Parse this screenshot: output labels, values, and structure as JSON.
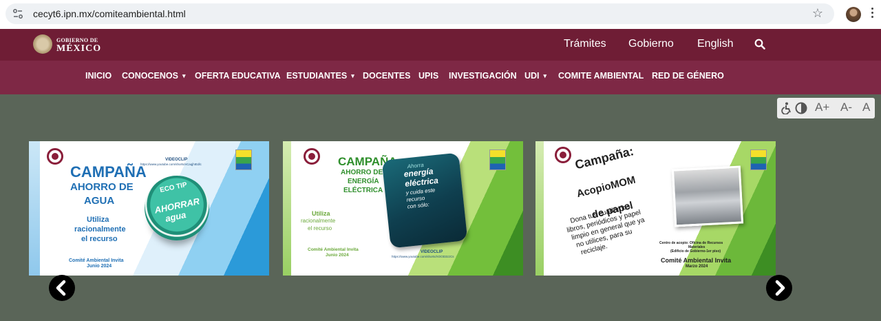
{
  "browser": {
    "url": "cecyt6.ipn.mx/comiteambiental.html",
    "icons": [
      "site-info-icon",
      "bookmark-star-icon",
      "profile-avatar",
      "kebab-menu-icon"
    ]
  },
  "gov_header": {
    "logo_small": "GOBIERNO DE",
    "logo_big": "MÉXICO",
    "links": {
      "tramites": "Trámites",
      "gobierno": "Gobierno",
      "english": "English"
    },
    "colors": {
      "top": "#6f1d35",
      "nav": "#7e2845"
    }
  },
  "nav": {
    "items": [
      {
        "label": "INICIO"
      },
      {
        "label": "CONOCENOS"
      },
      {
        "label": "OFERTA EDUCATIVA"
      },
      {
        "label": "ESTUDIANTES"
      },
      {
        "label": "DOCENTES"
      },
      {
        "label": "UPIS"
      },
      {
        "label": "INVESTIGACIÓN"
      },
      {
        "label": "UDI"
      },
      {
        "label": "COMITE AMBIENTAL"
      },
      {
        "label": "RED DE GÉNERO"
      }
    ],
    "caret": "▾"
  },
  "accessibility": {
    "increase": "A+",
    "decrease": "A-",
    "reset": "A"
  },
  "carousel": {
    "slides": [
      {
        "title1": "CAMPAÑA",
        "title2": "AHORRO DE",
        "title3": "AGUA",
        "sub1": "Utiliza",
        "sub2": "racionalmente",
        "sub3": "el recurso",
        "video_label": "VIDEOCLIP",
        "video_url": "https://www.youtube.com/shorts/vCaqjhIEdlc",
        "badge_top": "ECO TIP",
        "badge_main": "AHORRAR",
        "badge_sub": "agua",
        "footer1": "Comité Ambiental Invita",
        "footer2": "Junio 2024"
      },
      {
        "title1": "CAMPAÑA",
        "title2": "AHORRO DE",
        "title3": "ENERGÍA",
        "title4": "ELÉCTRICA",
        "sub1": "Utiliza",
        "sub2": "racionalmente",
        "sub3": "el recurso",
        "phone1": "Ahorra",
        "phone2": "energía",
        "phone3": "eléctrica",
        "phone4": "y cuida este",
        "phone5": "recurso",
        "phone6": "con sólo:",
        "video_label": "VIDEOCLIP",
        "video_url": "https://www.youtube.com/shorts/XOOD3zzCs",
        "footer1": "Comité Ambiental Invita",
        "footer2": "Junio 2024"
      },
      {
        "title1": "Campaña:",
        "title2": "AcopioMOM",
        "title3": "de papel",
        "body1": "Dona tus cuadernos,",
        "body2": "libros, periódicos y papel",
        "body3": "limpio en general que ya",
        "body4": "no utilices, para su",
        "body5": "reciclaje.",
        "center1": "Centro de acopio: Oficina de Recursos",
        "center2": "Materiales",
        "center3": "(Edificio de Gobierno-1er piso)",
        "footer1": "Comité Ambiental Invita",
        "footer2": "Marzo 2024"
      }
    ],
    "prev_icon": "chevron-left-icon",
    "next_icon": "chevron-right-icon"
  }
}
